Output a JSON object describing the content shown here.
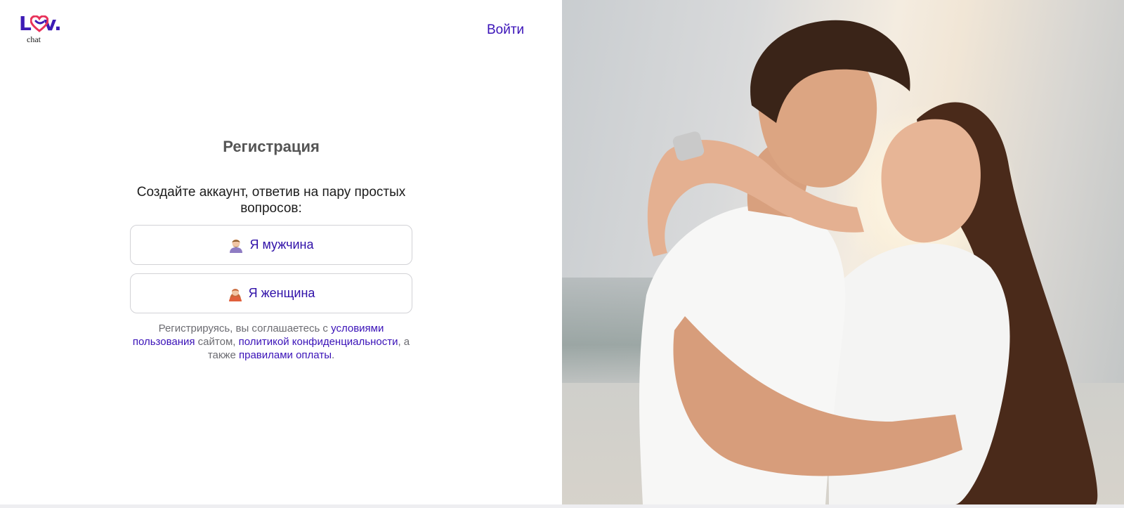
{
  "brand": {
    "logo_text": "L v.",
    "logo_sub": "chat",
    "accent_color": "#3a12b8",
    "heart_color": "#e8325a"
  },
  "header": {
    "login_label": "Войти"
  },
  "form": {
    "title": "Регистрация",
    "subtitle": "Создайте аккаунт, ответив на пару простых вопросов:",
    "options": [
      {
        "label": "Я мужчина",
        "icon": "man-emoji-icon"
      },
      {
        "label": "Я женщина",
        "icon": "woman-emoji-icon"
      }
    ],
    "terms": {
      "prefix": "Регистрируясь, вы соглашаетесь с ",
      "link_terms": "условиями пользования",
      "middle1": " сайтом, ",
      "link_privacy": "политикой конфиденциальности",
      "middle2": ", а также ",
      "link_payment": "правилами оплаты",
      "suffix": "."
    }
  },
  "hero": {
    "image": "couple-embracing-photo"
  }
}
